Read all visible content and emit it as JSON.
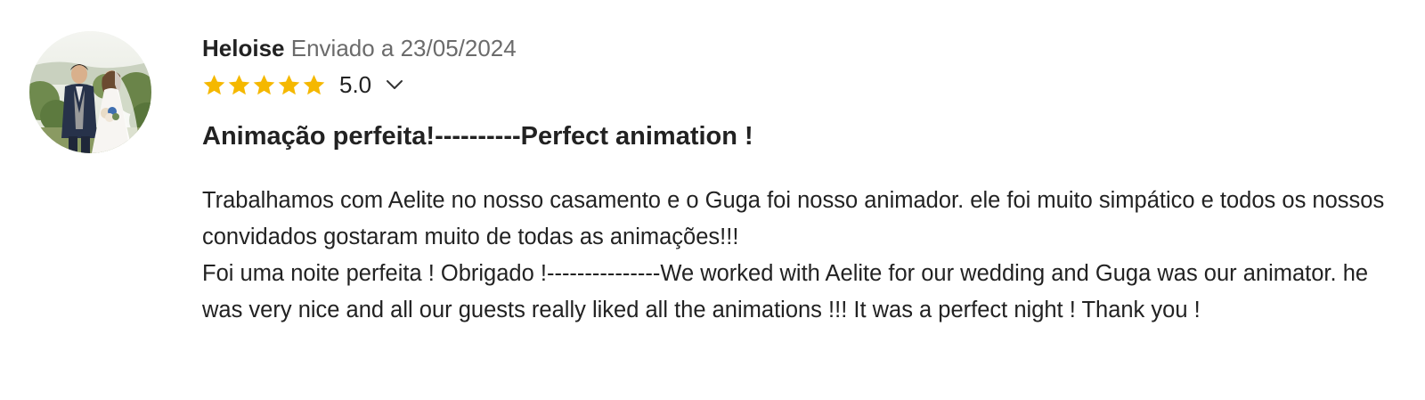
{
  "review": {
    "author": "Heloise",
    "sent_label": "Enviado a 23/05/2024",
    "rating": {
      "stars": 5,
      "max_stars": 5,
      "score_text": "5.0",
      "star_color": "#F5B800"
    },
    "title": "Animação perfeita!----------Perfect animation !",
    "body": [
      "Trabalhamos com Aelite no nosso casamento e o Guga foi nosso animador. ele foi muito simpático e todos os nossos convidados gostaram muito de todas as animações!!!",
      "Foi uma noite perfeita ! Obrigado !---------------We worked with Aelite for our wedding and Guga was our animator. he was very nice and all our guests really liked all the animations !!! It was a perfect night ! Thank you !"
    ]
  },
  "icons": {
    "avatar": "wedding-couple-photo",
    "star": "star-icon",
    "expand": "chevron-down-icon"
  }
}
